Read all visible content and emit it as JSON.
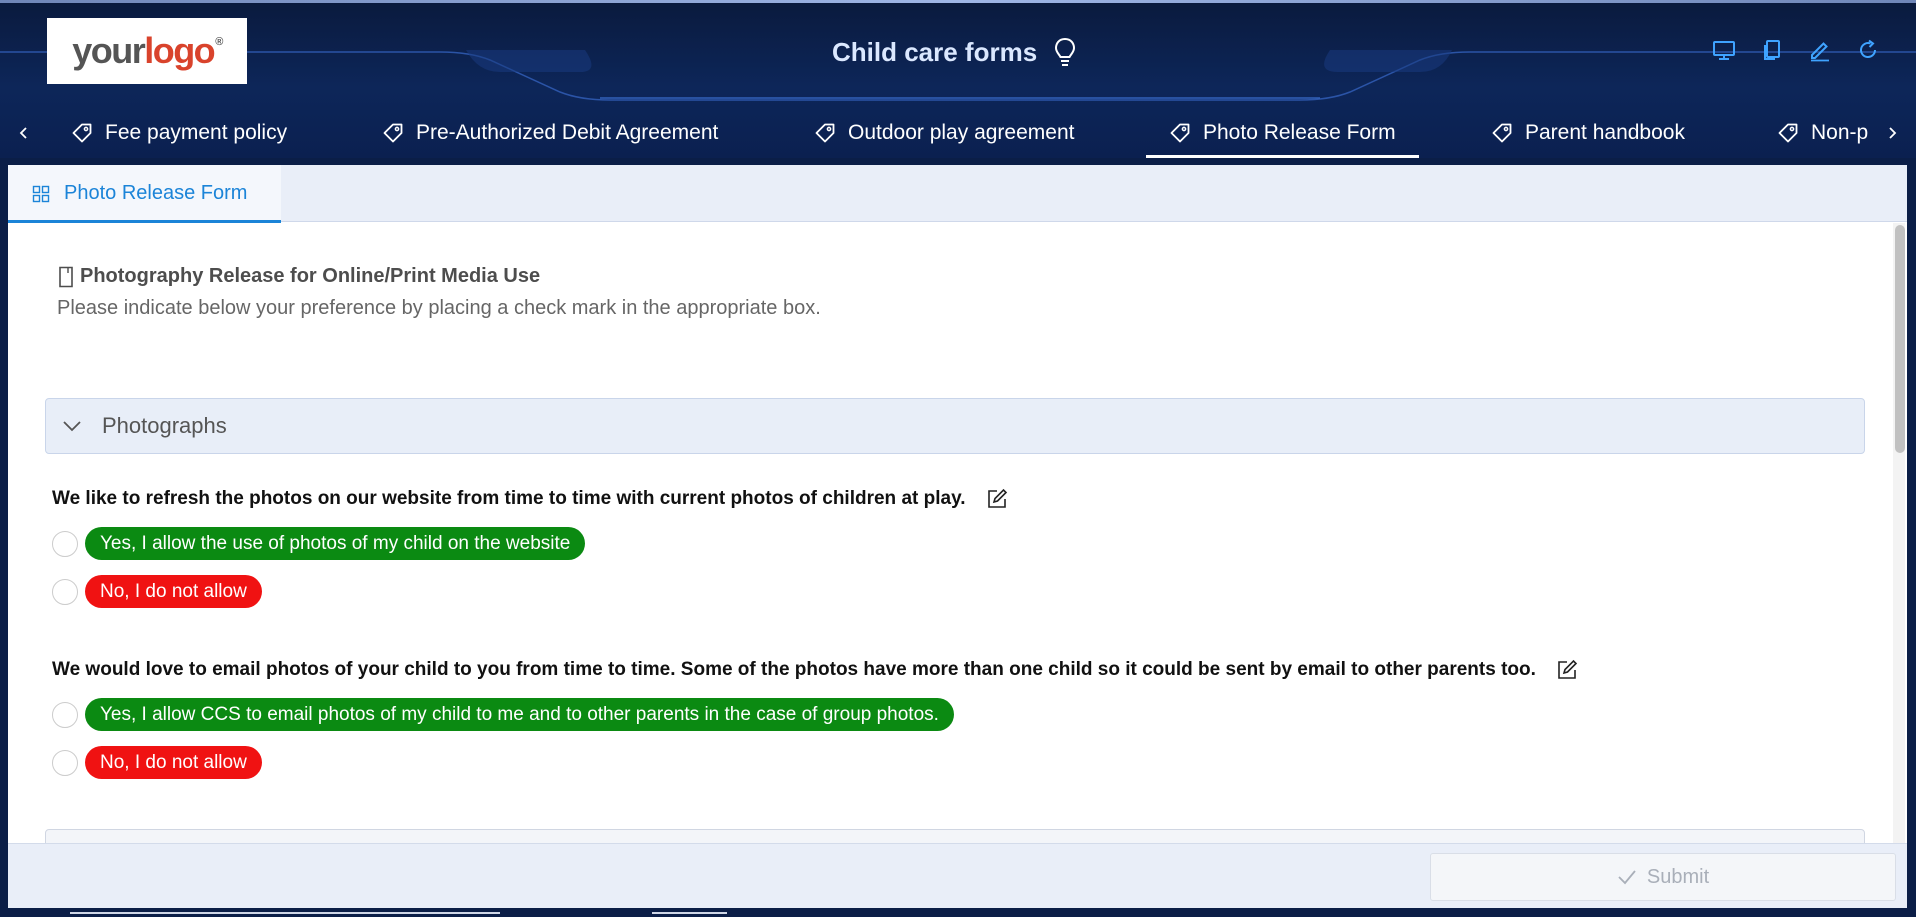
{
  "header": {
    "logo": {
      "part1": "your",
      "part2": "logo",
      "reg": "®"
    },
    "title": "Child care forms",
    "title_icon": "lightbulb-icon",
    "toolbar_icons": [
      "monitor-icon",
      "copy-icon",
      "pencil-icon",
      "refresh-icon"
    ]
  },
  "tabs": [
    {
      "label": "Fee payment policy",
      "icon": "tag-icon"
    },
    {
      "label": "Pre-Authorized Debit Agreement",
      "icon": "tag-icon"
    },
    {
      "label": "Outdoor play agreement",
      "icon": "tag-icon"
    },
    {
      "label": "Photo Release Form",
      "icon": "tag-icon",
      "active": true
    },
    {
      "label": "Parent handbook",
      "icon": "tag-icon"
    },
    {
      "label": "Non-p",
      "icon": "tag-icon"
    }
  ],
  "panel": {
    "tab_label": "Photo Release Form",
    "tab_icon": "grid-icon"
  },
  "form": {
    "heading": "Photography Release for Online/Print Media Use",
    "subheading": "Please indicate below your preference by placing a check mark in the appropriate box.",
    "section_title": "Photographs",
    "questions": [
      {
        "text": "We like to refresh the photos on our website from time to time with current photos of children at play.",
        "options": [
          {
            "label": "Yes, I allow the use of photos of my child on the website",
            "color": "#0b8a12",
            "checked": false
          },
          {
            "label": "No, I do not allow",
            "color": "#f01212",
            "checked": false
          }
        ]
      },
      {
        "text": "We would love to email photos of your child to you from time to time. Some of the photos have more than one child so it could be sent by email to other parents too.",
        "options": [
          {
            "label": "Yes, I allow CCS to email photos of my child to me and to other parents in the case of group photos.",
            "color": "#0b8a12",
            "checked": false
          },
          {
            "label": "No, I do not allow",
            "color": "#f01212",
            "checked": false
          }
        ]
      }
    ]
  },
  "footer": {
    "submit_label": "Submit",
    "submit_enabled": false
  },
  "colors": {
    "header_bg": "#0d2659",
    "accent_blue": "#1b84d8",
    "yes_green": "#0b8a12",
    "no_red": "#f01212"
  }
}
